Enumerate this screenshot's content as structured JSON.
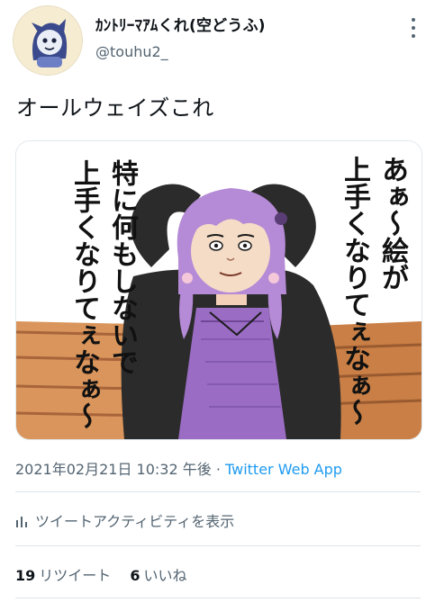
{
  "user": {
    "display_name": "ｶﾝﾄﾘｰﾏｱﾑくれ(空どうふ)",
    "handle": "@touhu2_"
  },
  "tweet": {
    "text": "オールウェイズこれ",
    "timestamp": "2021年02月21日 10:32 午後",
    "separator": " · ",
    "source": "Twitter Web App"
  },
  "image": {
    "left_caption": [
      "特に何もしないで",
      "上手くなりてぇなぁ〜"
    ],
    "right_caption": [
      "あぁ〜絵が",
      "上手くなりてぇなぁ〜"
    ]
  },
  "activity": {
    "label": "ツイートアクティビティを表示",
    "icon": "bar-chart-icon"
  },
  "stats": {
    "retweets_count": "19",
    "retweets_label": "リツイート",
    "likes_count": "6",
    "likes_label": "いいね"
  },
  "colors": {
    "link": "#1d9bf0",
    "secondary_text": "#536471",
    "hair": "#b58ad6",
    "dress": "#9b6cc4"
  }
}
